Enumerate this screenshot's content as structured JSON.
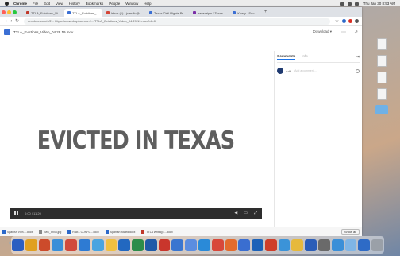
{
  "menubar": {
    "app": "Chrome",
    "items": [
      "File",
      "Edit",
      "View",
      "History",
      "Bookmarks",
      "People",
      "Window",
      "Help"
    ],
    "clock": "Thu Jan 30 8:53 AM"
  },
  "tabs": [
    {
      "label": "TTLA_Evictions_Vi...",
      "color": "#c0392b"
    },
    {
      "label": "TTLA_Evictions_...",
      "color": "#3b6fd4",
      "active": true
    },
    {
      "label": "Inbox (1) - jcarrillo@...",
      "color": "#d44638"
    },
    {
      "label": "Texas Civil Rights Pr...",
      "color": "#3b6fd4"
    },
    {
      "label": "transcripts / Texas...",
      "color": "#7b2fa8"
    },
    {
      "label": "Kuery - Suo...",
      "color": "#3b6fd4"
    }
  ],
  "toolbar": {
    "url": "dropbox.com/s/2... https://www.dropbox.com/.../TTLA_Evictions_Video_04.29.19.mov?dl=0"
  },
  "drive": {
    "file_name": "TTLA_Evictions_Video_04.29.19.mov",
    "open_with": "Download ▾"
  },
  "video": {
    "title": "EVICTED IN TEXAS",
    "time": "0:00 / 11:20"
  },
  "comments": {
    "tab_comments": "Comments",
    "tab_activity": "Info",
    "user_name": "Add",
    "placeholder": "Add a comment..."
  },
  "downloads": [
    "Spanish VOX....docx",
    "IMG_5943.jpg",
    "RAB - CONFL....docx",
    "Spanish Award.docx",
    "TTLA Writing I....docx"
  ],
  "downloads_show_all": "Show all",
  "desktop_icons": [
    {
      "label": "",
      "kind": "doc"
    },
    {
      "label": "",
      "kind": "doc"
    },
    {
      "label": "",
      "kind": "doc"
    },
    {
      "label": "",
      "kind": "doc"
    },
    {
      "label": "",
      "kind": "folder"
    }
  ],
  "dock_colors": [
    "#2b5fc1",
    "#e0a020",
    "#cc4b2b",
    "#3a8fd8",
    "#d14a3c",
    "#2e7bd3",
    "#4aa4e0",
    "#f0c040",
    "#2268c0",
    "#2d8c4a",
    "#1f5aa8",
    "#c9362c",
    "#3a76d0",
    "#5b8de0",
    "#2a8ad8",
    "#d8483a",
    "#e36b2d",
    "#3a6ed0",
    "#1c62b8",
    "#cf3e2a",
    "#3b93d8",
    "#e6b93c",
    "#2a5db8",
    "#6a6a6a",
    "#3b8fd8",
    "#7fb5e6",
    "#2e6bc6",
    "#9aa0a8"
  ]
}
